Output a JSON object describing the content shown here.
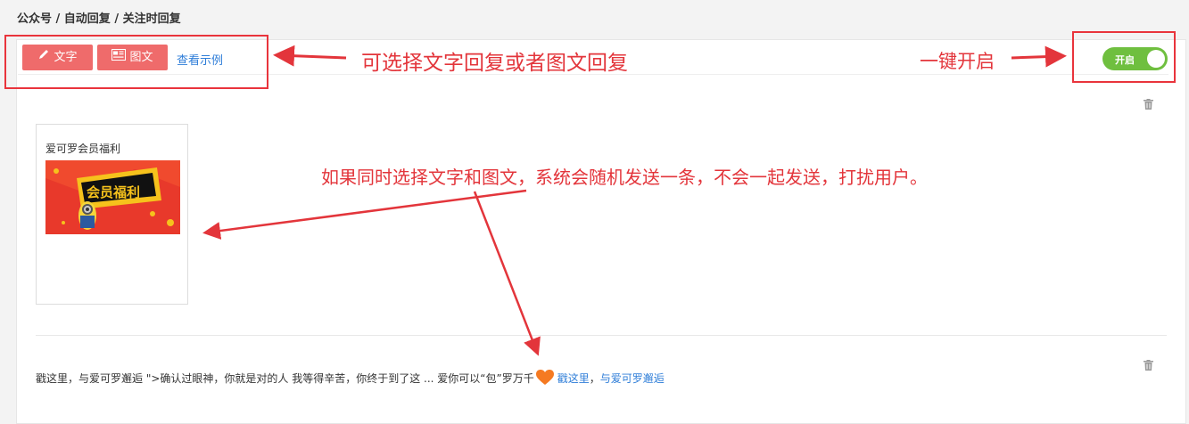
{
  "breadcrumb": "公众号 / 自动回复 / 关注时回复",
  "toolbar": {
    "text_button": "文字",
    "news_button": "图文",
    "example_link": "查看示例"
  },
  "toggle": {
    "label": "开启",
    "state": "on"
  },
  "annotations": {
    "choose_type": "可选择文字回复或者图文回复",
    "one_click": "一键开启",
    "random_note": "如果同时选择文字和图文，系统会随机发送一条，不会一起发送，打扰用户。"
  },
  "news_card": {
    "title": "爱可罗会员福利",
    "image_text": "会员福利"
  },
  "text_reply": {
    "content": "戳这里，与爱可罗邂逅 \">确认过眼神，你就是对的人 我等得辛苦，你终于到了这 ... 爱你可以“包”罗万千",
    "link1": "戳这里",
    "separator": "，",
    "link2": "与爱可罗邂逅"
  },
  "colors": {
    "accent_red": "#ef6b6b",
    "annotation_red": "#e3353b",
    "toggle_green": "#6fbf3f",
    "link_blue": "#2f7ed8"
  }
}
